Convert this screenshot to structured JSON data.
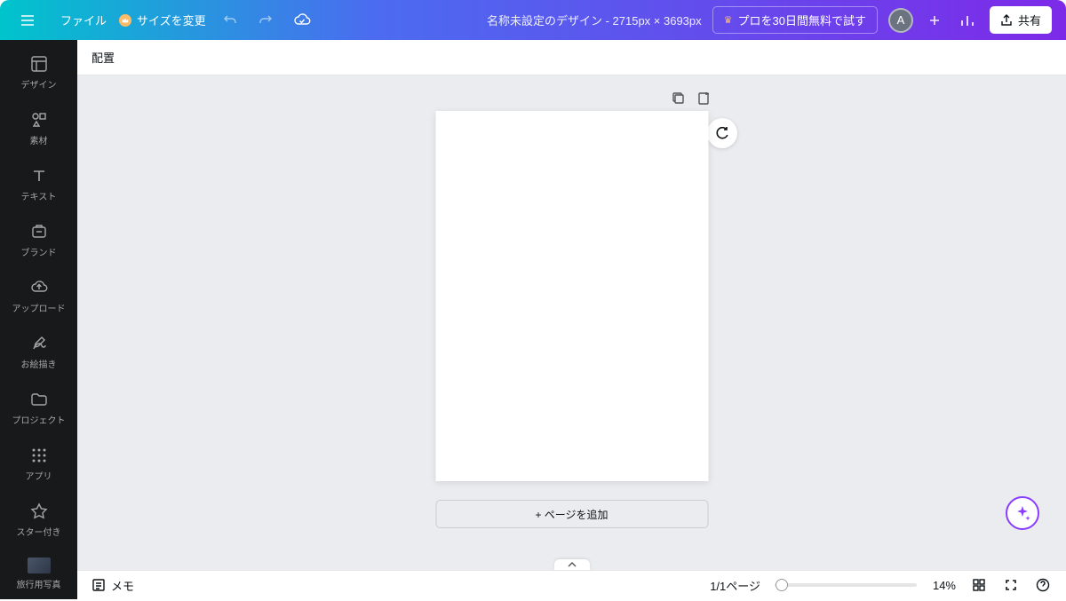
{
  "topbar": {
    "file_label": "ファイル",
    "resize_label": "サイズを変更",
    "design_title": "名称未設定のデザイン - 2715px × 3693px",
    "pro_trial_label": "プロを30日間無料で試す",
    "avatar_initial": "A",
    "share_label": "共有"
  },
  "sidebar": {
    "items": [
      {
        "label": "デザイン",
        "icon": "template"
      },
      {
        "label": "素材",
        "icon": "elements"
      },
      {
        "label": "テキスト",
        "icon": "text"
      },
      {
        "label": "ブランド",
        "icon": "brand"
      },
      {
        "label": "アップロード",
        "icon": "upload"
      },
      {
        "label": "お絵描き",
        "icon": "draw"
      },
      {
        "label": "プロジェクト",
        "icon": "projects"
      },
      {
        "label": "アプリ",
        "icon": "apps"
      },
      {
        "label": "スター付き",
        "icon": "star"
      },
      {
        "label": "旅行用写真",
        "icon": "travel"
      }
    ]
  },
  "subtoolbar": {
    "position_label": "配置"
  },
  "canvas": {
    "add_page_label": "+ ページを追加"
  },
  "bottombar": {
    "memo_label": "メモ",
    "page_indicator": "1/1ページ",
    "zoom_value": "14%"
  }
}
